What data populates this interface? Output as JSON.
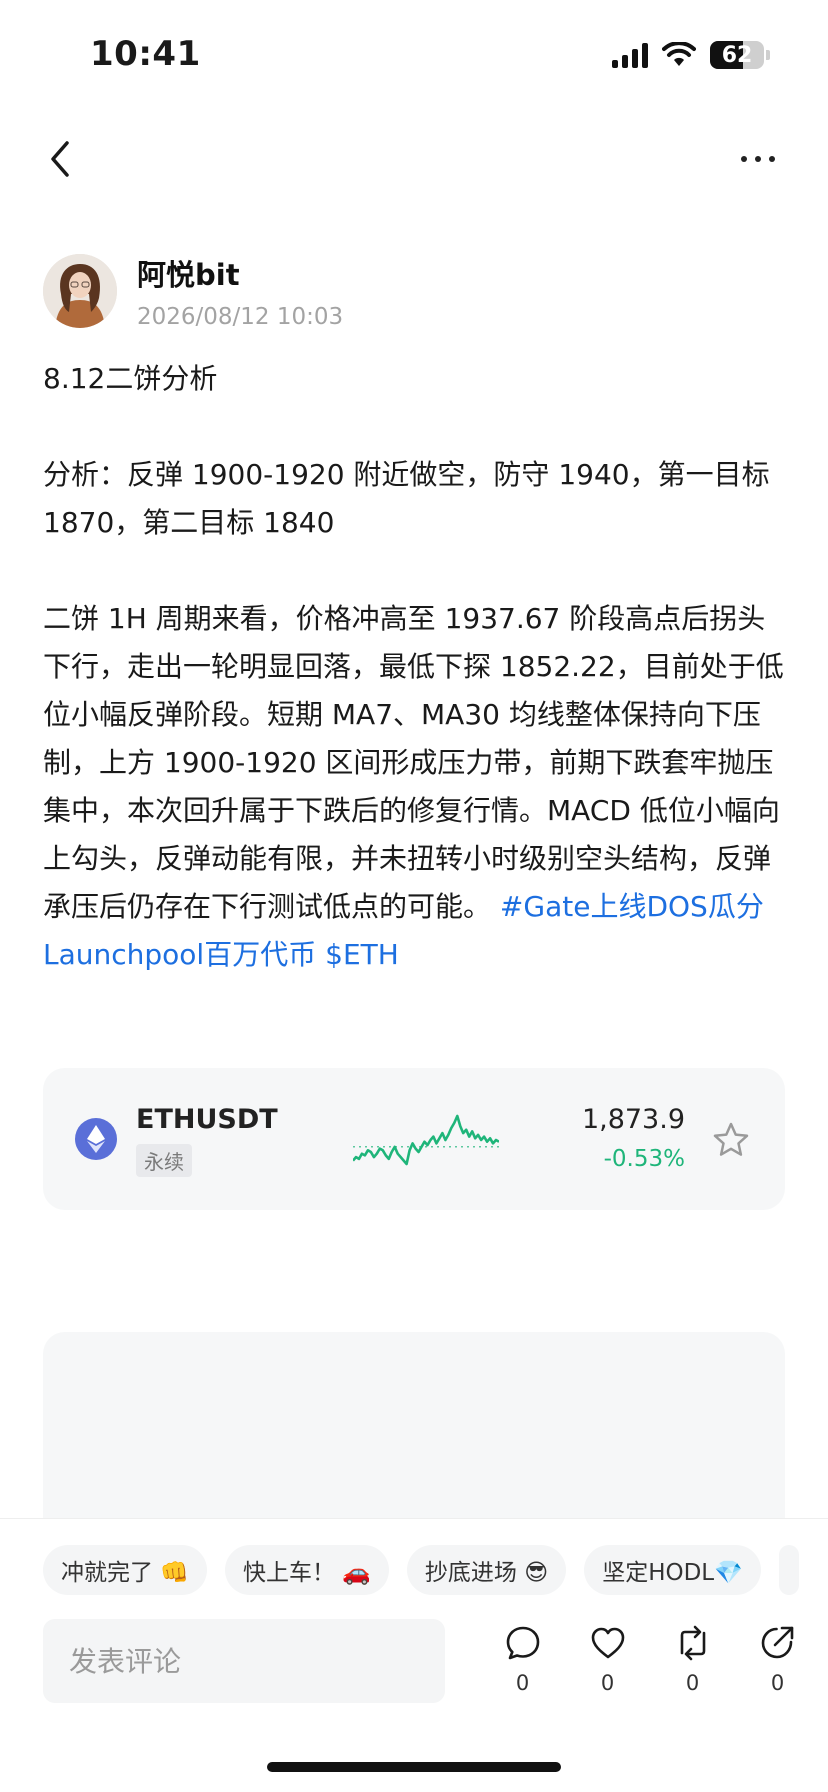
{
  "status_bar": {
    "time": "10:41",
    "battery": "62",
    "battery_level": 0.62
  },
  "nav": {
    "back_icon": "chevron-left-icon",
    "more_icon": "more-horizontal-icon"
  },
  "author": {
    "name": "阿悦bit",
    "timestamp": "2026/08/12 10:03"
  },
  "post": {
    "title": "8.12二饼分析",
    "summary": "分析：反弹 1900-1920 附近做空，防守 1940，第一目标 1870，第二目标 1840",
    "body": "二饼 1H 周期来看，价格冲高至 1937.67 阶段高点后拐头下行，走出一轮明显回落，最低下探 1852.22，目前处于低位小幅反弹阶段。短期 MA7、MA30 均线整体保持向下压制，上方 1900-1920 区间形成压力带，前期下跌套牢抛压集中，本次回升属于下跌后的修复行情。MACD 低位小幅向上勾头，反弹动能有限，并未扭转小时级别空头结构，反弹承压后仍存在下行测试低点的可能。",
    "tag_topic": "#Gate上线DOS瓜分Launchpool百万代币",
    "tag_ticker": "$ETH"
  },
  "ticker": {
    "symbol": "ETHUSDT",
    "badge": "永续",
    "price": "1,873.9",
    "change": "-0.53%",
    "change_color": "#1fb57a",
    "sparkline": [
      8,
      10,
      9,
      12,
      11,
      14,
      13,
      10,
      12,
      15,
      14,
      11,
      9,
      13,
      16,
      12,
      10,
      8,
      6,
      14,
      18,
      15,
      13,
      16,
      19,
      17,
      20,
      22,
      18,
      21,
      24,
      20,
      23,
      27,
      30,
      34,
      28,
      24,
      26,
      22,
      25,
      21,
      23,
      20,
      22,
      19,
      21,
      18,
      20,
      19
    ]
  },
  "quick_replies": [
    "冲就完了 👊",
    "快上车！ 🚗",
    "抄底进场 😎",
    "坚定HODL💎"
  ],
  "comment": {
    "placeholder": "发表评论"
  },
  "actions": [
    {
      "icon": "comment-icon",
      "count": "0"
    },
    {
      "icon": "heart-icon",
      "count": "0"
    },
    {
      "icon": "repost-icon",
      "count": "0"
    },
    {
      "icon": "share-icon",
      "count": "0"
    }
  ]
}
